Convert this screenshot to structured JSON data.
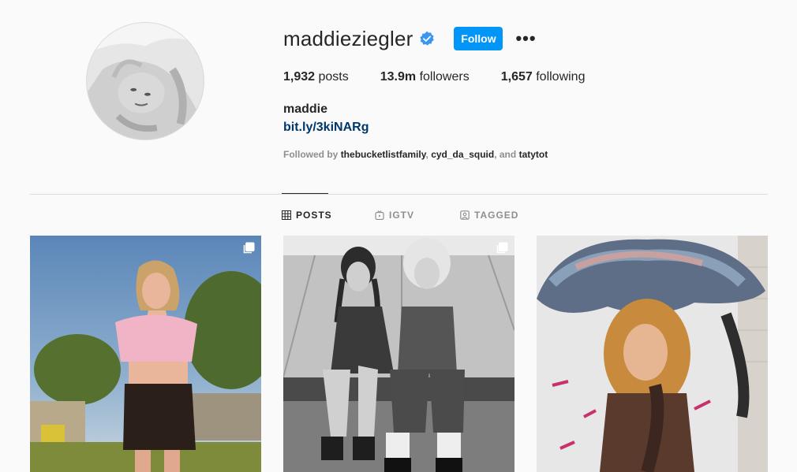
{
  "profile": {
    "username": "maddieziegler",
    "verified": true,
    "follow_label": "Follow",
    "more_label": "•••",
    "full_name": "maddie",
    "link": "bit.ly/3kiNARg"
  },
  "stats": {
    "posts_count": "1,932",
    "posts_label": "posts",
    "followers_count": "13.9m",
    "followers_label": "followers",
    "following_count": "1,657",
    "following_label": "following"
  },
  "followed_by": {
    "prefix": "Followed by",
    "user1": "thebucketlistfamily",
    "sep1": ",",
    "user2": "cyd_da_squid",
    "sep2": ", and",
    "user3": "tatytot"
  },
  "tabs": [
    {
      "label": "POSTS",
      "icon": "grid-icon",
      "active": true
    },
    {
      "label": "IGTV",
      "icon": "igtv-icon",
      "active": false
    },
    {
      "label": "TAGGED",
      "icon": "tagged-icon",
      "active": false
    }
  ],
  "posts": [
    {
      "icon": "multiple-photos-icon",
      "multi": true
    },
    {
      "icon": "multiple-photos-icon",
      "multi": true
    },
    {
      "multi": false
    }
  ],
  "colors": {
    "accent": "#0095f6",
    "link": "#00376b",
    "text": "#262626",
    "muted": "#8e8e8e",
    "verified": "#3897f0"
  }
}
